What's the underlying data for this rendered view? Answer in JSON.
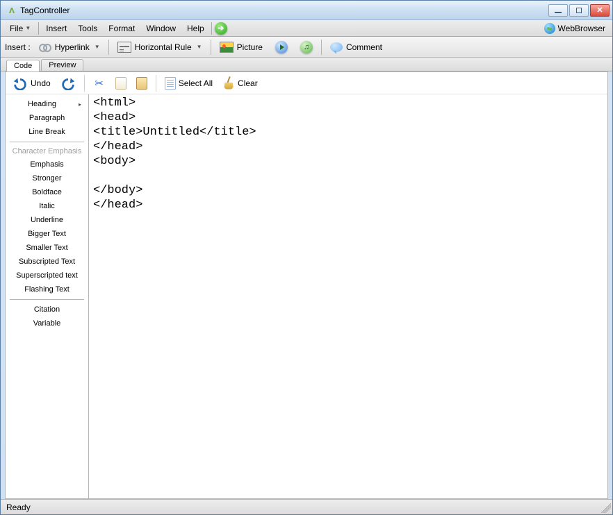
{
  "title": "TagController",
  "menu": {
    "file": "File",
    "insert": "Insert",
    "tools": "Tools",
    "format": "Format",
    "window": "Window",
    "help": "Help",
    "webbrowser": "WebBrowser"
  },
  "insertbar": {
    "label": "Insert :",
    "hyperlink": "Hyperlink",
    "hrule": "Horizontal Rule",
    "picture": "Picture",
    "comment": "Comment"
  },
  "tabs": {
    "code": "Code",
    "preview": "Preview"
  },
  "editbar": {
    "undo": "Undo",
    "selectall": "Select All",
    "clear": "Clear"
  },
  "sidebar": {
    "heading": "Heading",
    "paragraph": "Paragraph",
    "linebreak": "Line Break",
    "section_title": "Character Emphasis",
    "emphasis": "Emphasis",
    "stronger": "Stronger",
    "boldface": "Boldface",
    "italic": "Italic",
    "underline": "Underline",
    "bigger": "Bigger Text",
    "smaller": "Smaller Text",
    "subscript": "Subscripted Text",
    "superscript": "Superscripted text",
    "flashing": "Flashing Text",
    "citation": "Citation",
    "variable": "Variable"
  },
  "editor": {
    "content": "<html>\n<head>\n<title>Untitled</title>\n</head>\n<body>\n\n</body>\n</head>"
  },
  "status": "Ready"
}
